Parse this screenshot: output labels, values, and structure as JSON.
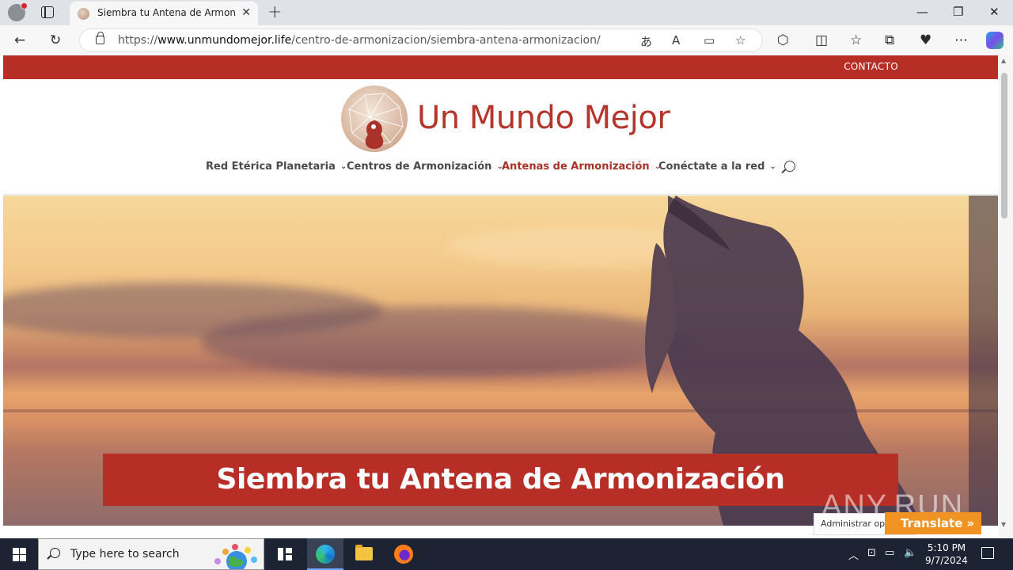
{
  "browser": {
    "tab_title": "Siembra tu Antena de Armonización",
    "url_prefix": "https://",
    "url_host": "www.unmundomejor.life",
    "url_path": "/centro-de-armonizacion/siembra-antena-armonizacion/"
  },
  "site": {
    "topbar_contact": "CONTACTO",
    "brand": "Un Mundo Mejor",
    "nav": [
      {
        "label": "Red Etérica Planetaria"
      },
      {
        "label": "Centros de Armonización"
      },
      {
        "label": "Antenas de Armonización"
      },
      {
        "label": "Conéctate a la red"
      }
    ],
    "hero_title": "Siembra tu Antena de Armonización",
    "admin_label": "Administrar opciones",
    "translate_label": "Translate »",
    "watermark": "ANY.RUN"
  },
  "taskbar": {
    "search_placeholder": "Type here to search",
    "time": "5:10 PM",
    "date": "9/7/2024"
  },
  "colors": {
    "brand_red": "#b72e26",
    "translate_orange": "#f09322"
  }
}
